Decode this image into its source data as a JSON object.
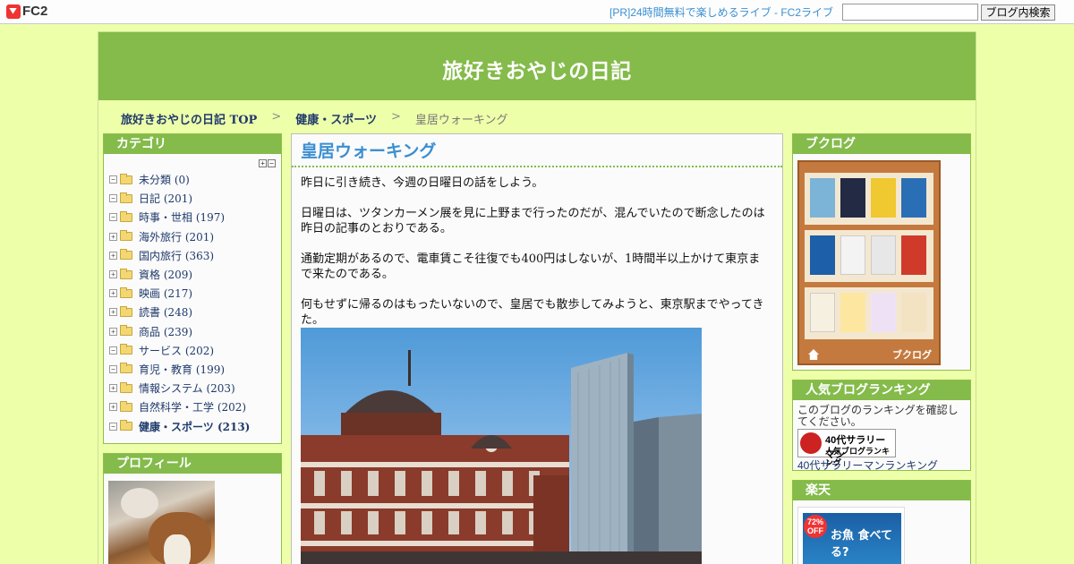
{
  "fc2bar": {
    "logo": "FC2",
    "pr_link": "[PR]24時間無料で楽しめるライブ - FC2ライブ",
    "search_value": "",
    "search_button": "ブログ内検索"
  },
  "blog": {
    "title": "旅好きおやじの日記"
  },
  "breadcrumb": {
    "home": "旅好きおやじの日記 TOP",
    "category": "健康・スポーツ",
    "current": "皇居ウォーキング",
    "separator": ">"
  },
  "sidebar": {
    "category_title": "カテゴリ",
    "categories": [
      {
        "label": "未分類 (0)"
      },
      {
        "label": "日記 (201)"
      },
      {
        "label": "時事・世相 (197)"
      },
      {
        "label": "海外旅行 (201)"
      },
      {
        "label": "国内旅行 (363)"
      },
      {
        "label": "資格 (209)"
      },
      {
        "label": "映画 (217)"
      },
      {
        "label": "読書 (248)"
      },
      {
        "label": "商品 (239)"
      },
      {
        "label": "サービス (202)"
      },
      {
        "label": "育児・教育 (199)"
      },
      {
        "label": "情報システム (203)"
      },
      {
        "label": "自然科学・工学 (202)"
      },
      {
        "label": "健康・スポーツ (213)"
      }
    ],
    "profile_title": "プロフィール"
  },
  "article": {
    "title": "皇居ウォーキング",
    "paragraphs": [
      "昨日に引き続き、今週の日曜日の話をしよう。",
      "日曜日は、ツタンカーメン展を見に上野まで行ったのだが、混んでいたので断念したのは昨日の記事のとおりである。",
      "通勤定期があるので、電車賃こそ往復でも400円はしないが、1時間半以上かけて東京まで来たのである。",
      "何もせずに帰るのはもったいないので、皇居でも散歩してみようと、東京駅までやってきた。"
    ]
  },
  "right": {
    "booklog_title": "ブクログ",
    "booklog_brand": "ブクログ",
    "ranking_title": "人気ブログランキング",
    "ranking_text": "このブログのランキングを確認してください。",
    "ranking_badge_title": "40代サラリーマン",
    "ranking_badge_sub": "人気ブログランキング",
    "ranking_link": "40代サラリーマンランキング",
    "rakuten_title": "楽天",
    "rakuten_off": "72% OFF",
    "rakuten_ad_text": "お魚 食べてる?"
  }
}
